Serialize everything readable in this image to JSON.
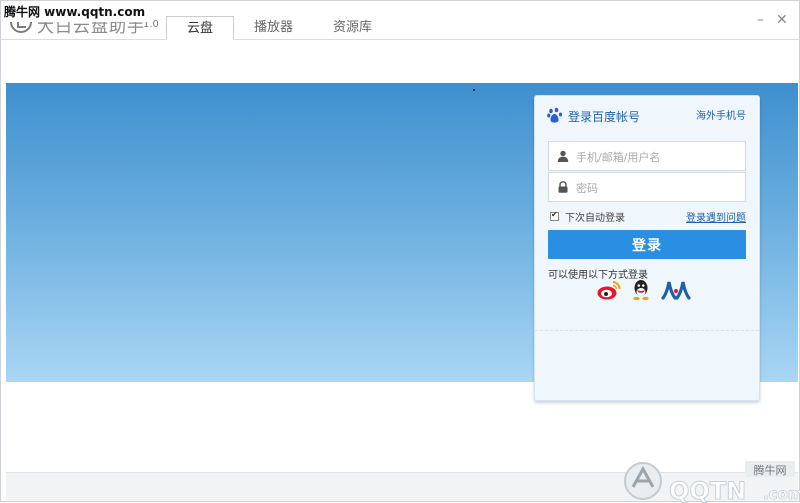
{
  "watermark_top": "腾牛网 www.qqtn.com",
  "app": {
    "title": "大白云盘助手",
    "version": "1.0"
  },
  "tabs": [
    {
      "label": "云盘",
      "active": true
    },
    {
      "label": "播放器",
      "active": false
    },
    {
      "label": "资源库",
      "active": false
    }
  ],
  "window_controls": {
    "minimize": "–",
    "close": "✕"
  },
  "login": {
    "title": "登录百度帐号",
    "overseas_link": "海外手机号",
    "username_placeholder": "手机/邮箱/用户名",
    "password_placeholder": "密码",
    "remember_label": "下次自动登录",
    "remember_checked": true,
    "trouble_link": "登录遇到问题",
    "button_label": "登录",
    "alt_label": "可以使用以下方式登录",
    "alt_methods": [
      "weibo-icon",
      "qq-icon",
      "renren-icon"
    ]
  },
  "corner_watermark": {
    "brand_cn": "腾牛网",
    "brand_en": "QQTN",
    "suffix": ".com"
  },
  "colors": {
    "accent": "#2a8ee3",
    "banner_top": "#3e8fcf",
    "banner_bottom": "#a9d6f4",
    "link": "#1f5fa8"
  }
}
